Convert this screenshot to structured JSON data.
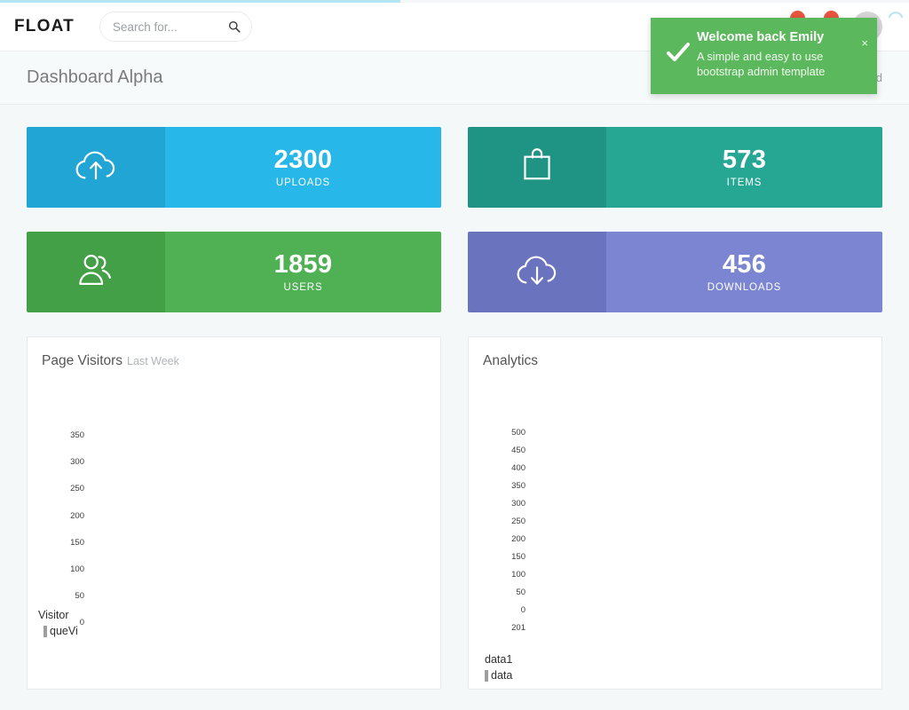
{
  "loading_bar": {
    "progress_percent": 44
  },
  "navbar": {
    "brand": "FLOAT",
    "search": {
      "placeholder": "Search for...",
      "value": "",
      "icon": "search-icon"
    },
    "notifications": [
      {
        "icon": "envelope-icon",
        "badge": "",
        "badge_color": "#e8543f"
      },
      {
        "icon": "bell-icon",
        "badge": "",
        "badge_color": "#e8543f"
      }
    ],
    "avatar_label": ""
  },
  "page_header": {
    "title": "Dashboard Alpha",
    "breadcrumb": "rd"
  },
  "stats": [
    {
      "value": "2300",
      "label": "UPLOADS",
      "icon": "cloud-upload-icon",
      "icon_bg": "#21a5d4",
      "body_bg": "#27b7e8"
    },
    {
      "value": "573",
      "label": "ITEMS",
      "icon": "shopping-bag-icon",
      "icon_bg": "#1f9484",
      "body_bg": "#26a794"
    },
    {
      "value": "1859",
      "label": "USERS",
      "icon": "users-icon",
      "icon_bg": "#43a047",
      "body_bg": "#50b154"
    },
    {
      "value": "456",
      "label": "DOWNLOADS",
      "icon": "cloud-download-icon",
      "icon_bg": "#6a73bd",
      "body_bg": "#7b85d1"
    }
  ],
  "panels": [
    {
      "title": "Page Visitors",
      "subtitle": "Last Week"
    },
    {
      "title": "Analytics",
      "subtitle": ""
    }
  ],
  "toast": {
    "title": "Welcome back Emily",
    "message": "A simple and easy to use bootstrap admin template",
    "close_label": "×",
    "icon": "check-icon",
    "background": "#5cb85c"
  },
  "chart_data": [
    {
      "type": "line",
      "title": "Page Visitors",
      "subtitle": "Last Week",
      "xlabel": "",
      "ylabel": "",
      "ylim": [
        0,
        350
      ],
      "y_ticks": [
        "350",
        "300",
        "250",
        "200",
        "150",
        "100",
        "50",
        "0"
      ],
      "x_ticks": [],
      "grid": false,
      "legend_position": "bottom-left",
      "legend": [
        "Visitor",
        "queVi"
      ],
      "series": [
        {
          "name": "Visitor",
          "values": []
        },
        {
          "name": "queVi",
          "values": []
        }
      ],
      "note": "plot body not rendered in screenshot; only axis tick labels and clipped legend visible"
    },
    {
      "type": "line",
      "title": "Analytics",
      "subtitle": "",
      "xlabel": "",
      "ylabel": "",
      "ylim": [
        0,
        500
      ],
      "y_ticks": [
        "500",
        "450",
        "400",
        "350",
        "300",
        "250",
        "200",
        "150",
        "100",
        "50",
        "0"
      ],
      "x_ticks": [
        "201"
      ],
      "grid": false,
      "legend_position": "bottom-left",
      "legend": [
        "data1",
        "data"
      ],
      "series": [
        {
          "name": "data1",
          "values": []
        },
        {
          "name": "data",
          "values": []
        }
      ],
      "note": "plot body not rendered in screenshot; only axis tick labels and clipped legend visible"
    }
  ]
}
